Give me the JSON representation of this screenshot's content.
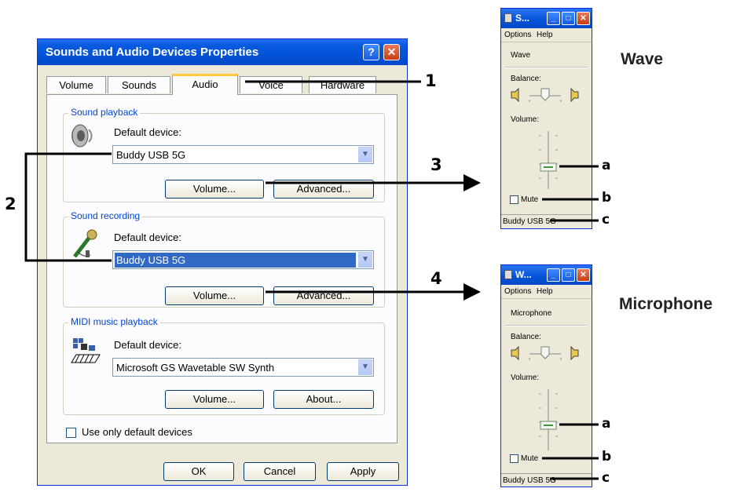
{
  "dialog": {
    "title": "Sounds and Audio Devices Properties",
    "help_glyph": "?",
    "close_glyph": "✕",
    "tabs": [
      "Volume",
      "Sounds",
      "Audio",
      "Voice",
      "Hardware"
    ],
    "active_tab": "Audio",
    "playback": {
      "group_label": "Sound playback",
      "default_label": "Default device:",
      "device": "Buddy USB 5G",
      "volume_button": "Volume...",
      "advanced_button": "Advanced..."
    },
    "recording": {
      "group_label": "Sound recording",
      "default_label": "Default device:",
      "device": "Buddy USB 5G",
      "volume_button": "Volume...",
      "advanced_button": "Advanced..."
    },
    "midi": {
      "group_label": "MIDI music playback",
      "default_label": "Default device:",
      "device": "Microsoft GS Wavetable SW Synth",
      "volume_button": "Volume...",
      "about_button": "About..."
    },
    "use_only_default": "Use only default devices",
    "buttons": {
      "ok": "OK",
      "cancel": "Cancel",
      "apply": "Apply"
    }
  },
  "wave_mixer": {
    "title": "S...",
    "menu": [
      "Options",
      "Help"
    ],
    "channel": "Wave",
    "balance_label": "Balance:",
    "volume_label": "Volume:",
    "mute_label": "Mute",
    "status": "Buddy USB 5G",
    "heading": "Wave"
  },
  "mic_mixer": {
    "title": "W...",
    "menu": [
      "Options",
      "Help"
    ],
    "channel": "Microphone",
    "balance_label": "Balance:",
    "volume_label": "Volume:",
    "mute_label": "Mute",
    "status": "Buddy USB 5G",
    "heading": "Microphone"
  },
  "annotations": {
    "n1": "1",
    "n2": "2",
    "n3": "3",
    "n4": "4",
    "wave_a": "a",
    "wave_b": "b",
    "wave_c": "c",
    "mic_a": "a",
    "mic_b": "b",
    "mic_c": "c"
  },
  "colors": {
    "title_blue": "#0453d8",
    "group_label": "#0046d5",
    "selection": "#316ac5",
    "tab_highlight": "#ffc83c",
    "close_red": "#c73d16"
  }
}
